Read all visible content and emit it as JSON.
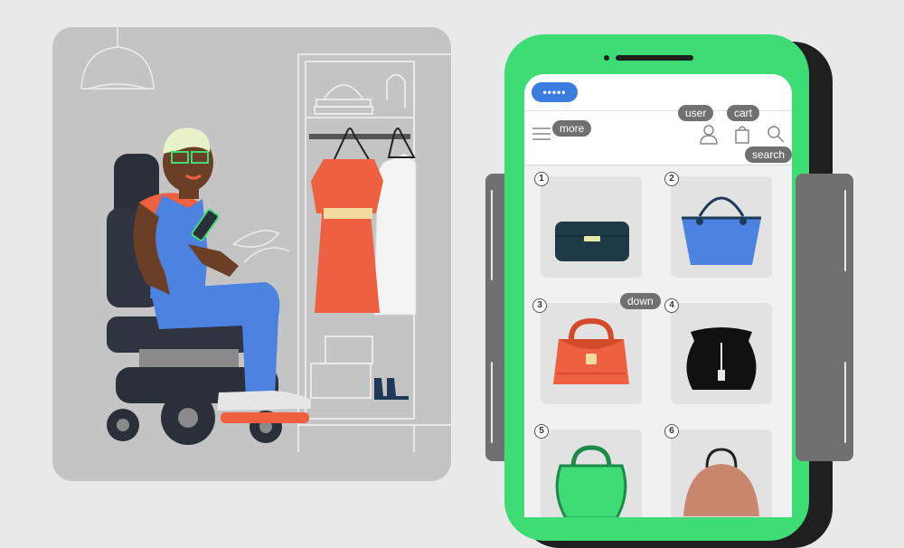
{
  "scene": {
    "description_icons": [
      "person-in-wheelchair-illustration",
      "wardrobe-icon",
      "lamp-icon",
      "plant-icon"
    ],
    "colors": {
      "background": "#c4c4c4",
      "dress": "#ee6040",
      "overalls": "#4c82e0"
    }
  },
  "app": {
    "logo_text": "•••••",
    "colors": {
      "accent": "#3b7dde",
      "phone_frame": "#3ddc75",
      "label_bg": "#707070"
    }
  },
  "voice_labels": {
    "user": "user",
    "cart": "cart",
    "more": "more",
    "search": "search",
    "down": "down"
  },
  "products": [
    {
      "number": "1",
      "icon": "clutch-icon"
    },
    {
      "number": "2",
      "icon": "tote-bag-icon"
    },
    {
      "number": "3",
      "icon": "handbag-icon"
    },
    {
      "number": "4",
      "icon": "pouch-bag-icon"
    },
    {
      "number": "5",
      "icon": "green-bag-icon"
    },
    {
      "number": "6",
      "icon": "brown-bag-icon"
    }
  ]
}
